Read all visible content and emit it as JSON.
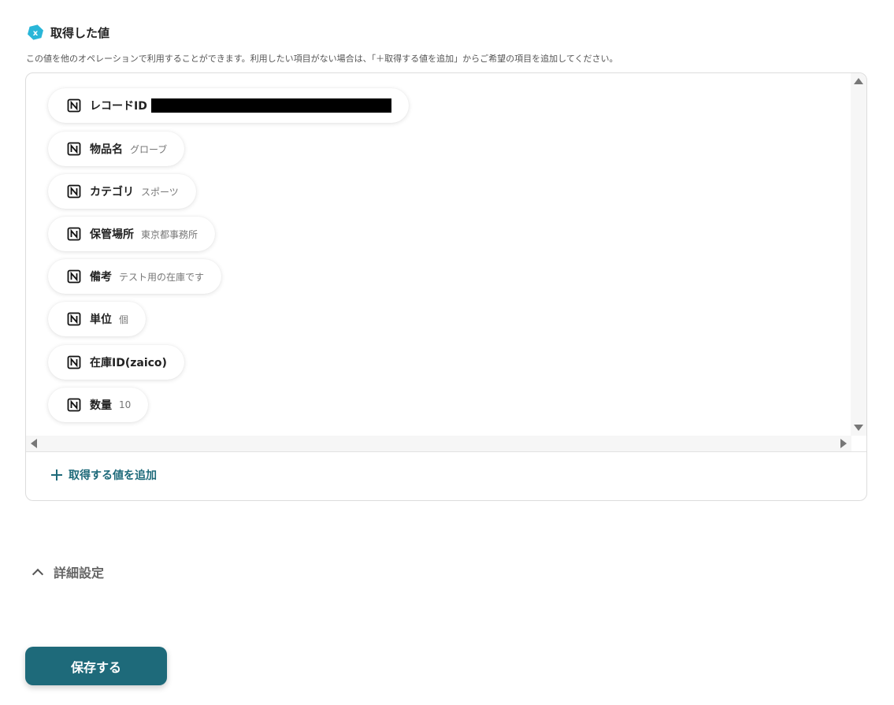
{
  "section": {
    "title": "取得した値",
    "description": "この値を他のオペレーションで利用することができます。利用したい項目がない場合は、「＋取得する値を追加」からご希望の項目を追加してください。"
  },
  "fields": [
    {
      "label": "レコードID",
      "value": "",
      "redacted": true
    },
    {
      "label": "物品名",
      "value": "グローブ"
    },
    {
      "label": "カテゴリ",
      "value": "スポーツ"
    },
    {
      "label": "保管場所",
      "value": "東京都事務所"
    },
    {
      "label": "備考",
      "value": "テスト用の在庫です"
    },
    {
      "label": "単位",
      "value": "個"
    },
    {
      "label": "在庫ID(zaico)",
      "value": ""
    },
    {
      "label": "数量",
      "value": "10"
    }
  ],
  "add_value_label": "取得する値を追加",
  "advanced_label": "詳細設定",
  "save_label": "保存する",
  "colors": {
    "accent": "#1e6a7a",
    "hex_icon": "#29b6d8"
  }
}
